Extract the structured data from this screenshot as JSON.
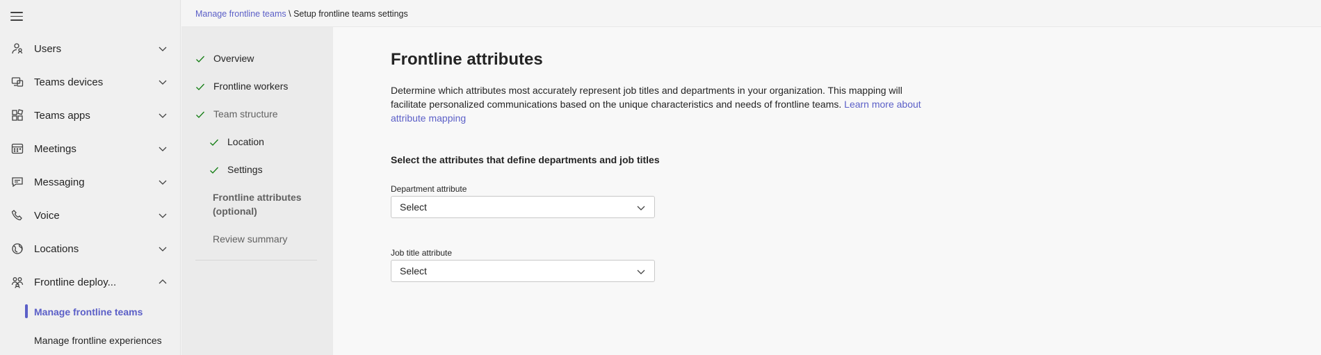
{
  "leftnav": {
    "menu_icon": "hamburger-icon",
    "items": [
      {
        "label": "Users",
        "icon": "users-icon",
        "expanded": false
      },
      {
        "label": "Teams devices",
        "icon": "devices-icon",
        "expanded": false
      },
      {
        "label": "Teams apps",
        "icon": "apps-icon",
        "expanded": false
      },
      {
        "label": "Meetings",
        "icon": "calendar-icon",
        "expanded": false
      },
      {
        "label": "Messaging",
        "icon": "chat-icon",
        "expanded": false
      },
      {
        "label": "Voice",
        "icon": "phone-icon",
        "expanded": false
      },
      {
        "label": "Locations",
        "icon": "globe-icon",
        "expanded": false
      },
      {
        "label": "Frontline deploy...",
        "icon": "frontline-people-icon",
        "expanded": true
      }
    ],
    "sub_items": [
      {
        "label": "Manage frontline teams",
        "active": true
      },
      {
        "label": "Manage frontline experiences",
        "active": false
      }
    ]
  },
  "breadcrumb": {
    "link": "Manage frontline teams",
    "separator": " \\ ",
    "current": "Setup frontline teams settings"
  },
  "steps": [
    {
      "label": "Overview",
      "state": "done"
    },
    {
      "label": "Frontline workers",
      "state": "done"
    },
    {
      "label": "Team structure",
      "state": "done"
    },
    {
      "label": "Location",
      "state": "done"
    },
    {
      "label": "Settings",
      "state": "done"
    },
    {
      "label_line1": "Frontline attributes",
      "label_line2": "(optional)",
      "state": "current"
    },
    {
      "label": "Review summary",
      "state": "pending"
    }
  ],
  "main": {
    "title": "Frontline attributes",
    "description": "Determine which attributes most accurately represent job titles and departments in your organization. This mapping will facilitate personalized communications based on the unique characteristics and needs of frontline teams. ",
    "learn_more_link": "Learn more about attribute mapping",
    "section_title": "Select the attributes that define departments and job titles",
    "department_label": "Department attribute",
    "department_value": "Select",
    "jobtitle_label": "Job title attribute",
    "jobtitle_value": "Select"
  },
  "colors": {
    "accent": "#5b5fc7",
    "nav_bg": "#f0f0f0",
    "steps_bg": "#ebebeb",
    "main_bg": "#f8f8f8"
  }
}
